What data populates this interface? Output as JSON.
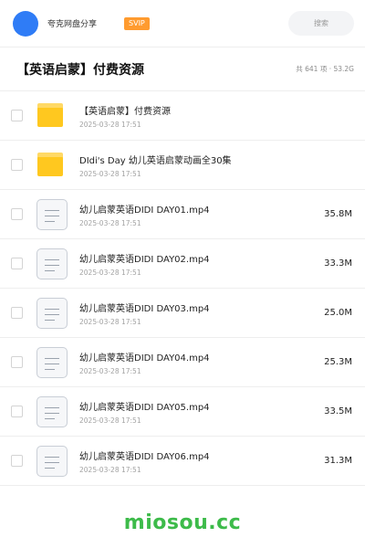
{
  "header": {
    "user_name": "夸克网盘分享",
    "badge": "SVIP",
    "search_placeholder": "搜索",
    "colors": {
      "avatar": "#2f7cf6",
      "badge": "#ff9b2f"
    }
  },
  "folder": {
    "title": "【英语启蒙】付费资源",
    "summary": "共 641 项 · 53.2G"
  },
  "files": [
    {
      "type": "folder",
      "icon": "folder-icon",
      "name": "【英语启蒙】付费资源",
      "date": "2025-03-28 17:51",
      "size": ""
    },
    {
      "type": "folder",
      "icon": "folder-icon",
      "name": "DIdi's Day 幼儿英语启蒙动画全30集",
      "date": "2025-03-28 17:51",
      "size": ""
    },
    {
      "type": "file",
      "icon": "file-icon",
      "name": "幼儿启蒙英语DIDI DAY01.mp4",
      "date": "2025-03-28 17:51",
      "size": "35.8M"
    },
    {
      "type": "file",
      "icon": "file-icon",
      "name": "幼儿启蒙英语DIDI DAY02.mp4",
      "date": "2025-03-28 17:51",
      "size": "33.3M"
    },
    {
      "type": "file",
      "icon": "file-icon",
      "name": "幼儿启蒙英语DIDI DAY03.mp4",
      "date": "2025-03-28 17:51",
      "size": "25.0M"
    },
    {
      "type": "file",
      "icon": "file-icon",
      "name": "幼儿启蒙英语DIDI DAY04.mp4",
      "date": "2025-03-28 17:51",
      "size": "25.3M"
    },
    {
      "type": "file",
      "icon": "file-icon",
      "name": "幼儿启蒙英语DIDI DAY05.mp4",
      "date": "2025-03-28 17:51",
      "size": "33.5M"
    },
    {
      "type": "file",
      "icon": "file-icon",
      "name": "幼儿启蒙英语DIDI DAY06.mp4",
      "date": "2025-03-28 17:51",
      "size": "31.3M"
    }
  ],
  "watermark": "miosou.cc",
  "colors": {
    "folder": "#ffc81f",
    "watermark": "#3dbb4a"
  }
}
